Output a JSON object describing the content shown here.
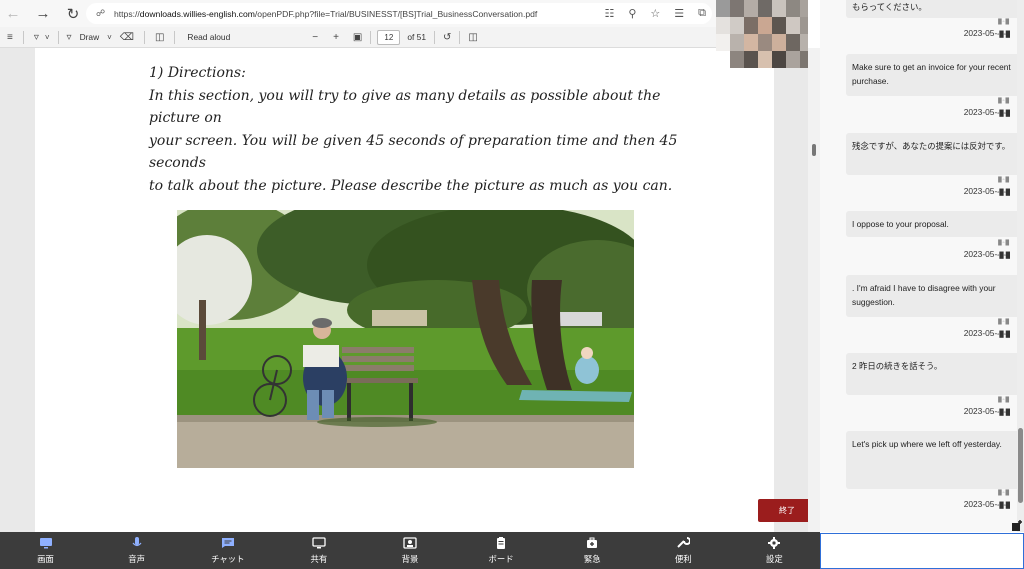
{
  "browser": {
    "url_prefix": "https://",
    "url_host": "downloads.willies-english.com",
    "url_path": "/openPDF.php?file=Trial/BUSINESST/[BS]Trial_BusinessConversation.pdf"
  },
  "pdf_toolbar": {
    "draw_label": "Draw",
    "read_aloud_label": "Read aloud",
    "page_number": "12",
    "page_total": "of 51"
  },
  "pdf_content": {
    "heading": "1) Directions:",
    "line1": "In this section, you will try to give as many details as possible about the picture on",
    "line2": "your screen.  You will be given 45 seconds of preparation time and then 45 seconds",
    "line3": "to talk about the picture.  Please describe the picture as much as you can."
  },
  "end_button": "終了",
  "chat": {
    "messages": [
      {
        "text": "もらってください。",
        "date": "2023-05-"
      },
      {
        "text": "Make sure to get an invoice for your recent purchase.",
        "date": "2023-05-"
      },
      {
        "text": "残念ですが、あなたの提案には反対です。",
        "date": "2023-05-"
      },
      {
        "text": "I oppose to your proposal.",
        "date": "2023-05-"
      },
      {
        "text": ". I'm afraid I have to disagree with your suggestion.",
        "date": "2023-05-"
      },
      {
        "text": "2 昨日の続きを話そう。",
        "date": "2023-05-"
      },
      {
        "text": "Let's pick up where we left off yesterday.",
        "date": "2023-05-"
      }
    ]
  },
  "bottom_bar": {
    "items": [
      {
        "label": "画面",
        "icon": "screen-icon"
      },
      {
        "label": "音声",
        "icon": "microphone-icon"
      },
      {
        "label": "チャット",
        "icon": "chat-icon"
      },
      {
        "label": "共有",
        "icon": "share-icon"
      },
      {
        "label": "背景",
        "icon": "background-icon"
      },
      {
        "label": "ボード",
        "icon": "board-icon"
      },
      {
        "label": "緊急",
        "icon": "emergency-icon"
      },
      {
        "label": "便利",
        "icon": "tools-icon"
      },
      {
        "label": "設定",
        "icon": "settings-icon"
      }
    ]
  },
  "colors": {
    "accent_blue": "#2f6fd8",
    "end_button": "#9b1d1d",
    "bottom_bar": "#3c3c3c",
    "bottom_icon": "#8fb0ff"
  }
}
